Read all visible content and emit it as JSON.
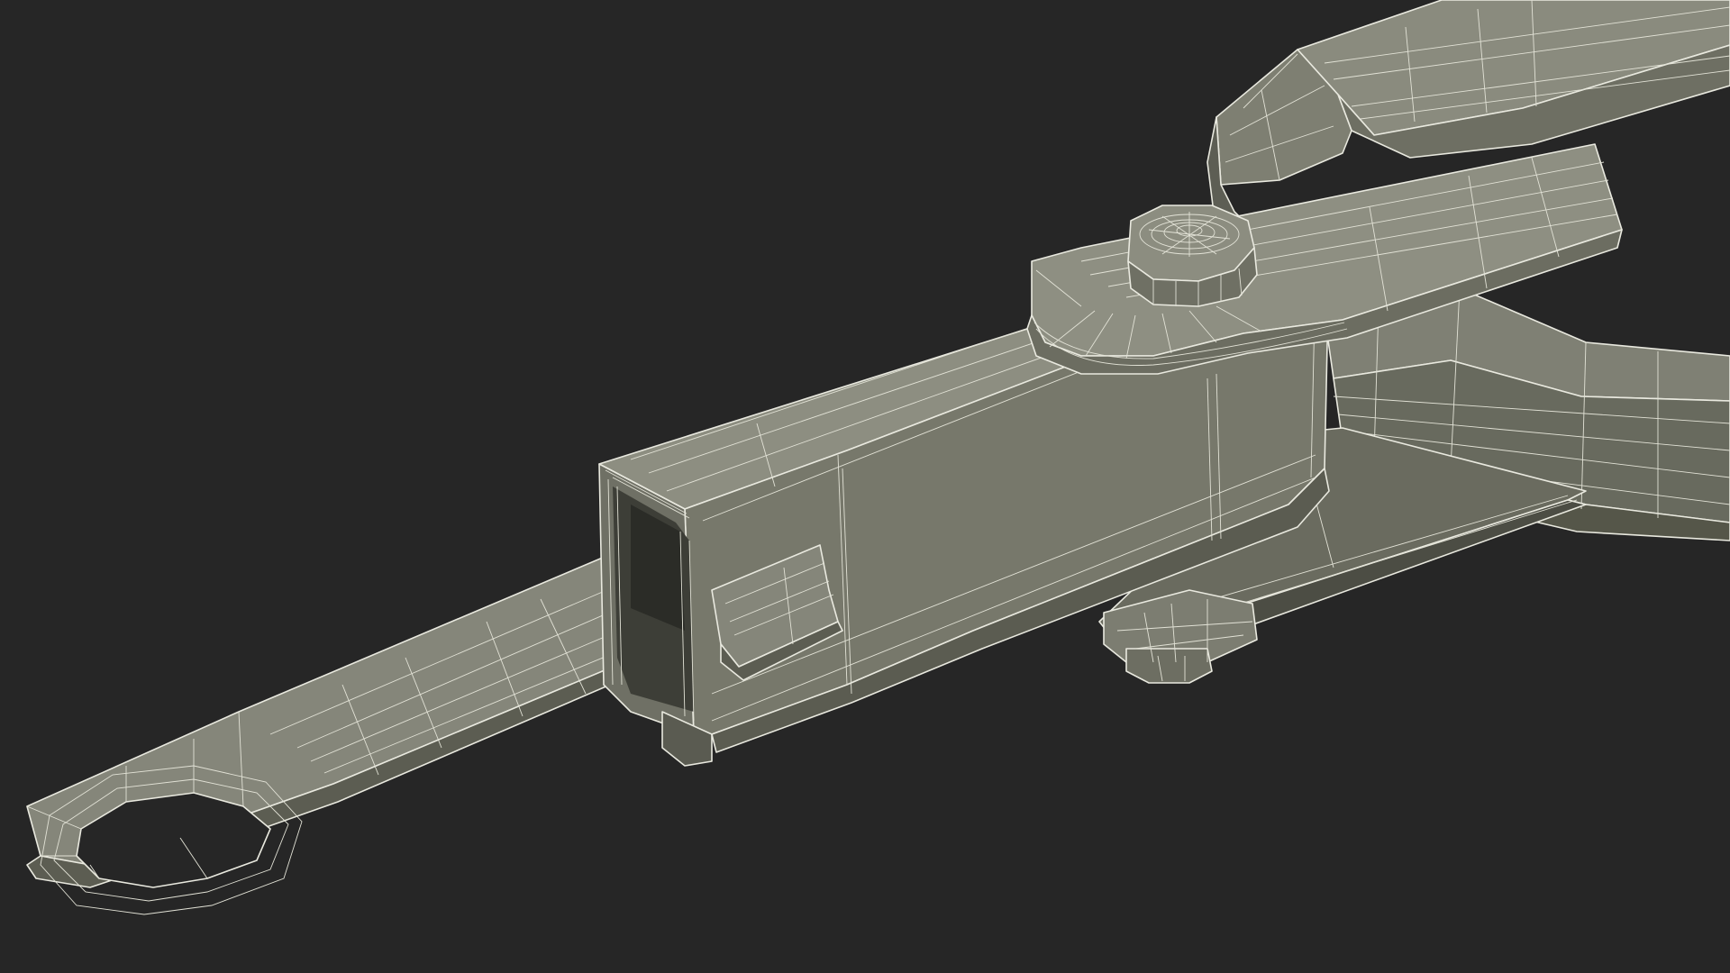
{
  "scene": {
    "subject": "towing-hitch-bar-wireframe",
    "colors": {
      "background": "#262626",
      "surface_light": "#8a8b7e",
      "surface_mid": "#76776b",
      "surface_dark": "#55564c",
      "surface_shadow": "#3e3f37",
      "wireframe": "#e6e6dc"
    }
  }
}
